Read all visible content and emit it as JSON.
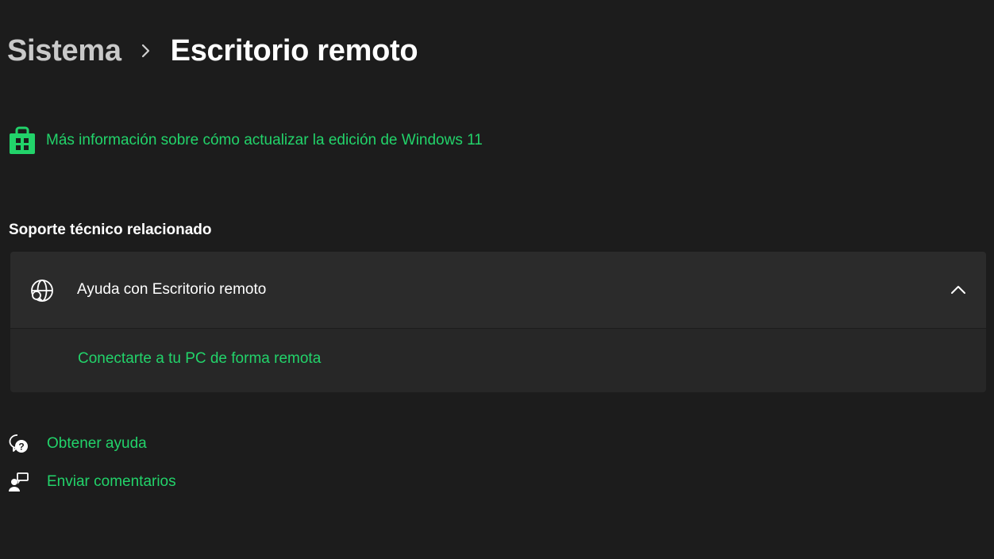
{
  "breadcrumb": {
    "parent": "Sistema",
    "current": "Escritorio remoto"
  },
  "upgrade": {
    "icon": "store-icon",
    "text": "Más información sobre cómo actualizar la edición de Windows 11"
  },
  "related_support": {
    "title": "Soporte técnico relacionado",
    "card": {
      "icon": "globe-search-icon",
      "label": "Ayuda con Escritorio remoto",
      "expanded": true,
      "links": [
        "Conectarte a tu PC de forma remota"
      ]
    }
  },
  "footer": {
    "get_help": "Obtener ayuda",
    "feedback": "Enviar comentarios"
  },
  "colors": {
    "background": "#1c1c1c",
    "card_header": "#2b2b2b",
    "card_body": "#272727",
    "accent_link": "#22d36a",
    "muted_text": "#c9c9c9"
  }
}
